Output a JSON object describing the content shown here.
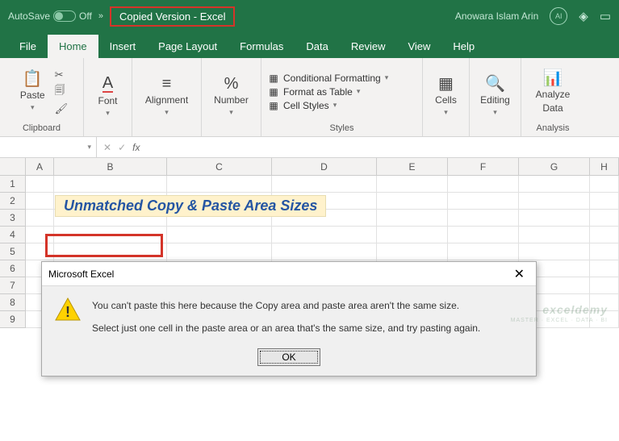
{
  "title": {
    "autosave": "AutoSave",
    "toggle_off": "Off",
    "doc_title": "Copied Version  -  Excel",
    "user": "Anowara Islam Arin",
    "avatar": "AI"
  },
  "tabs": [
    "File",
    "Home",
    "Insert",
    "Page Layout",
    "Formulas",
    "Data",
    "Review",
    "View",
    "Help"
  ],
  "ribbon": {
    "clipboard": {
      "paste": "Paste",
      "label": "Clipboard"
    },
    "font": {
      "btn": "Font"
    },
    "alignment": {
      "btn": "Alignment"
    },
    "number": {
      "btn": "Number"
    },
    "styles": {
      "cond": "Conditional Formatting",
      "table": "Format as Table",
      "cell": "Cell Styles",
      "label": "Styles"
    },
    "cells": {
      "btn": "Cells"
    },
    "editing": {
      "btn": "Editing"
    },
    "analysis": {
      "btn1": "Analyze",
      "btn2": "Data",
      "label": "Analysis"
    }
  },
  "formula_bar": {
    "name": "",
    "fx": "fx"
  },
  "columns": {
    "A": "A",
    "B": "B",
    "C": "C",
    "D": "D",
    "E": "E",
    "F": "F",
    "G": "G",
    "H": "H"
  },
  "col_widths": {
    "A": 35,
    "B": 140,
    "C": 130,
    "D": 130,
    "E": 88,
    "F": 88,
    "G": 88,
    "H": 36
  },
  "rows_count": 9,
  "sheet_heading": "Unmatched Copy & Paste Area Sizes",
  "dialog": {
    "title": "Microsoft Excel",
    "line1": "You can't paste this here because the Copy area and paste area aren't the same size.",
    "line2": "Select just one cell in the paste area or an area that's the same size, and try pasting again.",
    "ok": "OK"
  },
  "watermark": {
    "main": "exceldemy",
    "sub": "MASTER · EXCEL · DATA · BI"
  }
}
